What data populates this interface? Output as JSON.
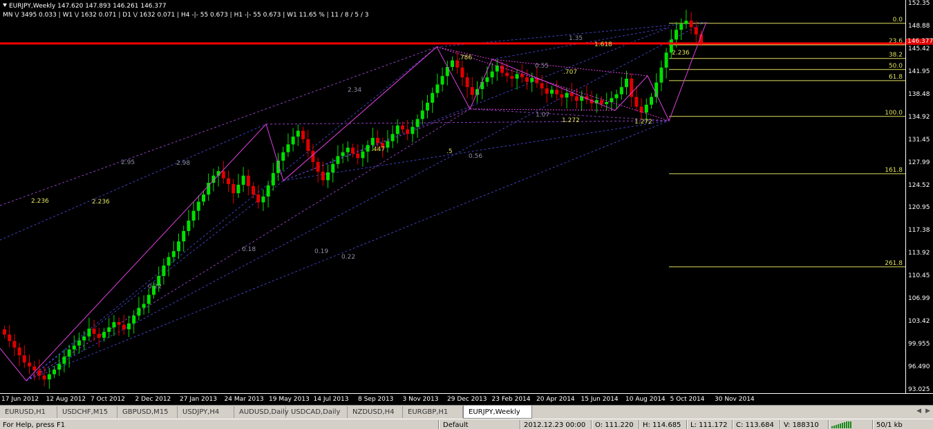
{
  "header": {
    "line1": "EURJPY,Weekly  147.620 147.893 146.261 146.377",
    "line2": "MN \\/ 3495   0.033  |  W1 \\/ 1632   0.071  |  D1 \\/ 1632   0.071  |  H4 -|- 55   0.673  |  H1 -|- 55   0.673  |  W1  11.65 %  | 11 / 8 / 5 / 3"
  },
  "price_axis": [
    "152.35",
    "148.88",
    "145.42",
    "141.95",
    "138.48",
    "134.92",
    "131.45",
    "127.99",
    "124.52",
    "120.95",
    "117.38",
    "113.92",
    "110.45",
    "106.99",
    "103.42",
    "99.955",
    "96.490",
    "93.025"
  ],
  "current_price": "146.377",
  "time_axis": [
    "17 Jun 2012",
    "12 Aug 2012",
    "7 Oct 2012",
    "2 Dec 2012",
    "27 Jan 2013",
    "24 Mar 2013",
    "19 May 2013",
    "14 Jul 2013",
    "8 Sep 2013",
    "3 Nov 2013",
    "29 Dec 2013",
    "23 Feb 2014",
    "20 Apr 2014",
    "15 Jun 2014",
    "10 Aug 2014",
    "5 Oct 2014",
    "30 Nov 2014"
  ],
  "fib_levels": [
    {
      "label": "0.0",
      "price": 149.3
    },
    {
      "label": "23.6",
      "price": 146.0
    },
    {
      "label": "38.2",
      "price": 143.9
    },
    {
      "label": "50.0",
      "price": 142.2
    },
    {
      "label": "61.8",
      "price": 140.5
    },
    {
      "label": "100.0",
      "price": 135.0
    },
    {
      "label": "161.8",
      "price": 126.2
    },
    {
      "label": "261.8",
      "price": 111.9
    }
  ],
  "pattern_labels": [
    {
      "text": "1.35",
      "color": "#9090a8"
    },
    {
      "text": "1.618",
      "color": "#e0e060"
    },
    {
      "text": ".786",
      "color": "#e0e060"
    },
    {
      "text": "0.55",
      "color": "#9090a8"
    },
    {
      "text": ".707",
      "color": "#e0e060"
    },
    {
      "text": "2.236",
      "color": "#e0e060"
    },
    {
      "text": "2.34",
      "color": "#9090a8"
    },
    {
      "text": "1.07",
      "color": "#9090a8"
    },
    {
      "text": "1.272",
      "color": "#e0e060"
    },
    {
      "text": "1.272",
      "color": "#e0e060"
    },
    {
      "text": ".447",
      "color": "#e0e060"
    },
    {
      "text": ".5",
      "color": "#e0e060"
    },
    {
      "text": "0.56",
      "color": "#9090a8"
    },
    {
      "text": "2.95",
      "color": "#9090a8"
    },
    {
      "text": "2.98",
      "color": "#9090a8"
    },
    {
      "text": "2.236",
      "color": "#e0e060"
    },
    {
      "text": "2.236",
      "color": "#e0e060"
    },
    {
      "text": "0.18",
      "color": "#9090a8"
    },
    {
      "text": "0.19",
      "color": "#9090a8"
    },
    {
      "text": "0.22",
      "color": "#9090a8"
    },
    {
      "text": "0.22",
      "color": "#9090a8"
    }
  ],
  "tabs": [
    {
      "label": "EURUSD,H1",
      "active": false
    },
    {
      "label": "USDCHF,M15",
      "active": false
    },
    {
      "label": "GBPUSD,M15",
      "active": false
    },
    {
      "label": "USDJPY,H4",
      "active": false
    },
    {
      "label": "AUDUSD,Daily",
      "active": false
    },
    {
      "label": "USDCAD,Daily",
      "active": false
    },
    {
      "label": "NZDUSD,H4",
      "active": false
    },
    {
      "label": "EURGBP,H1",
      "active": false
    },
    {
      "label": "EURJPY,Weekly",
      "active": true
    }
  ],
  "status": {
    "help": "For Help, press F1",
    "profile": "Default",
    "datetime": "2012.12.23 00:00",
    "open": "O: 111.220",
    "high": "H: 114.685",
    "low": "L: 111.172",
    "close": "C: 113.684",
    "volume": "V: 188310",
    "traffic": "50/1 kb"
  },
  "colors": {
    "bull": "#00e000",
    "bear": "#e00000",
    "resistance": "#ff0000",
    "pattern": "#e040e0",
    "projection": "#4040c0",
    "fib": "#e0e060"
  },
  "chart_data": {
    "type": "candlestick",
    "symbol": "EURJPY",
    "timeframe": "Weekly",
    "ylim": [
      93.025,
      152.35
    ],
    "close_prices": [
      101.5,
      100.5,
      99.5,
      98.3,
      97.2,
      96.6,
      96.0,
      95.2,
      94.6,
      95.4,
      96.1,
      97.0,
      98.1,
      99.2,
      99.8,
      100.6,
      101.2,
      102.4,
      101.6,
      101.0,
      101.9,
      102.6,
      103.4,
      103.0,
      102.3,
      103.2,
      104.4,
      105.6,
      106.2,
      107.6,
      109.0,
      110.5,
      112.1,
      113.4,
      114.3,
      115.8,
      117.4,
      119.0,
      120.5,
      121.9,
      123.0,
      124.8,
      125.9,
      126.6,
      125.5,
      124.6,
      123.2,
      124.5,
      125.9,
      124.3,
      123.0,
      121.8,
      122.7,
      124.4,
      126.3,
      128.2,
      129.5,
      130.7,
      131.9,
      132.8,
      131.5,
      129.7,
      128.0,
      126.5,
      125.2,
      126.4,
      127.7,
      128.9,
      129.5,
      130.2,
      129.3,
      128.6,
      129.6,
      130.6,
      131.7,
      130.9,
      130.2,
      131.2,
      132.3,
      133.6,
      133.0,
      132.3,
      133.4,
      134.6,
      135.9,
      137.1,
      138.6,
      139.9,
      141.2,
      142.6,
      143.6,
      142.5,
      141.0,
      139.5,
      138.3,
      139.2,
      140.3,
      141.0,
      141.9,
      142.8,
      141.7,
      141.2,
      140.8,
      141.5,
      141.0,
      140.3,
      140.9,
      140.1,
      139.3,
      138.5,
      139.1,
      138.4,
      137.9,
      138.6,
      138.1,
      137.4,
      138.1,
      137.6,
      137.0,
      137.5,
      136.9,
      137.2,
      137.8,
      138.4,
      139.5,
      140.8,
      138.0,
      136.5,
      135.6,
      136.8,
      138.0,
      140.2,
      142.5,
      144.8,
      146.8,
      148.3,
      149.2,
      149.7,
      148.7,
      147.6,
      146.377
    ]
  }
}
